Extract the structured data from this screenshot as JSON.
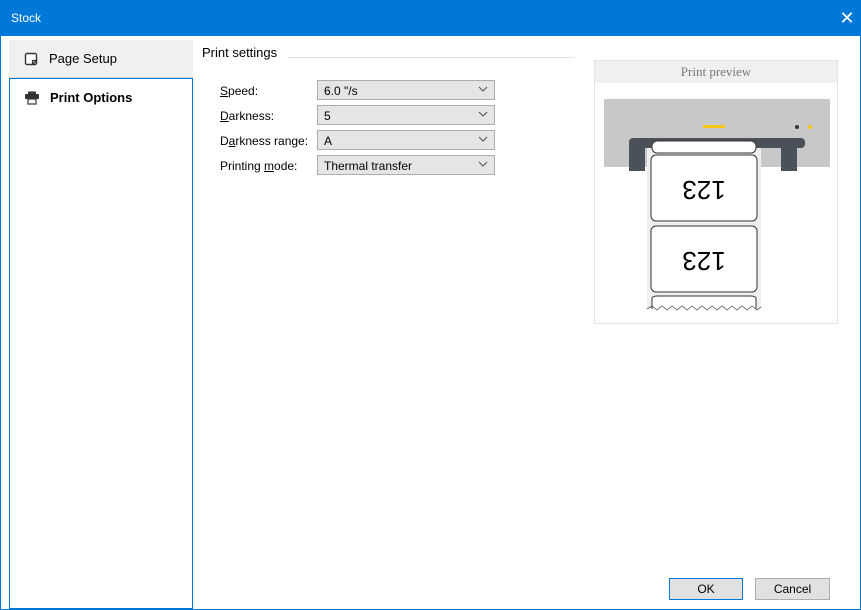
{
  "window": {
    "title": "Stock",
    "close_symbol": "✕"
  },
  "sidebar": {
    "items": [
      {
        "label": "Page Setup",
        "icon": "page-setup-icon",
        "active": false
      },
      {
        "label": "Print Options",
        "icon": "printer-icon",
        "active": true
      }
    ]
  },
  "print_settings": {
    "section_label": "Print settings",
    "fields": [
      {
        "label_hotkey": "S",
        "label_rest": "peed:",
        "value": "6.0 \"/s"
      },
      {
        "label_hotkey": "D",
        "label_rest": "arkness:",
        "value": "5"
      },
      {
        "label_pre": "D",
        "label_hotkey": "a",
        "label_rest": "rkness range:",
        "value": "A"
      },
      {
        "label_pre": "Printing ",
        "label_hotkey": "m",
        "label_rest": "ode:",
        "value": "Thermal transfer"
      }
    ]
  },
  "preview": {
    "title": "Print preview",
    "label_text": "123"
  },
  "buttons": {
    "ok": "OK",
    "cancel": "Cancel"
  },
  "colors": {
    "accent": "#0078d7",
    "printer_body": "#c8c8c8",
    "printer_slot": "#4a5158",
    "status_light": "#f5c518"
  }
}
